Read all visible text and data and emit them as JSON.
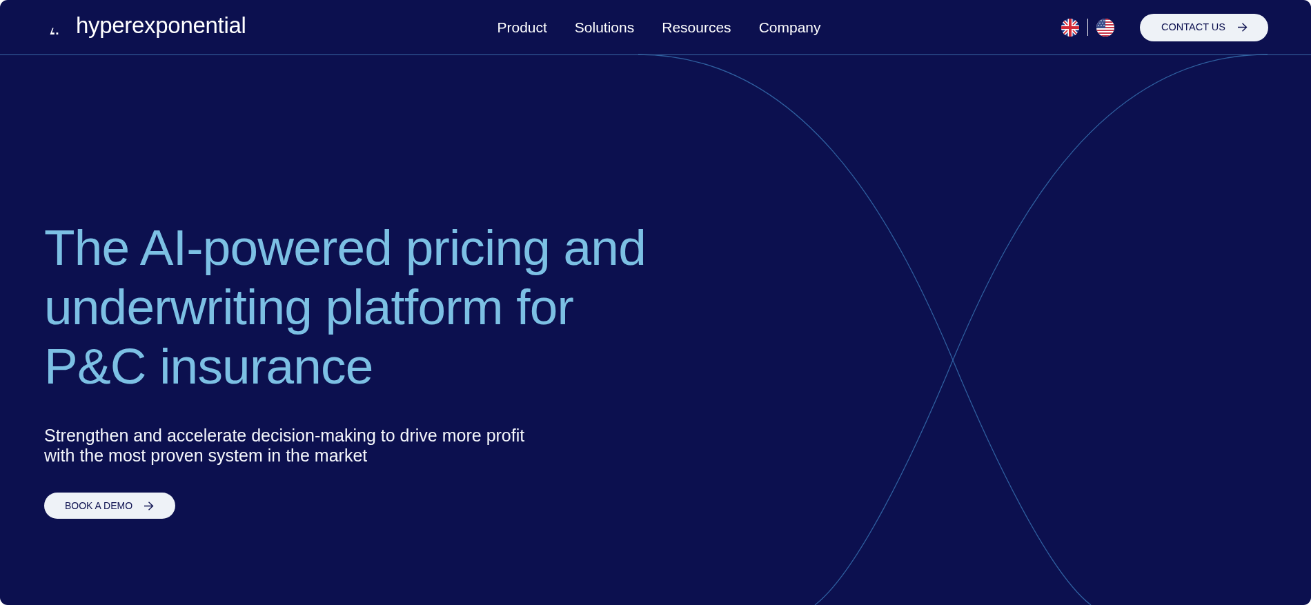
{
  "header": {
    "logo_text": "hyperexponential",
    "nav": [
      {
        "label": "Product"
      },
      {
        "label": "Solutions"
      },
      {
        "label": "Resources"
      },
      {
        "label": "Company"
      }
    ],
    "contact_button": "CONTACT US"
  },
  "hero": {
    "headline": "The AI-powered pricing and underwriting platform for P&C insurance",
    "subtitle": "Strengthen and accelerate decision-making to drive more profit with the most proven system in the market",
    "cta_button": "BOOK A DEMO"
  }
}
